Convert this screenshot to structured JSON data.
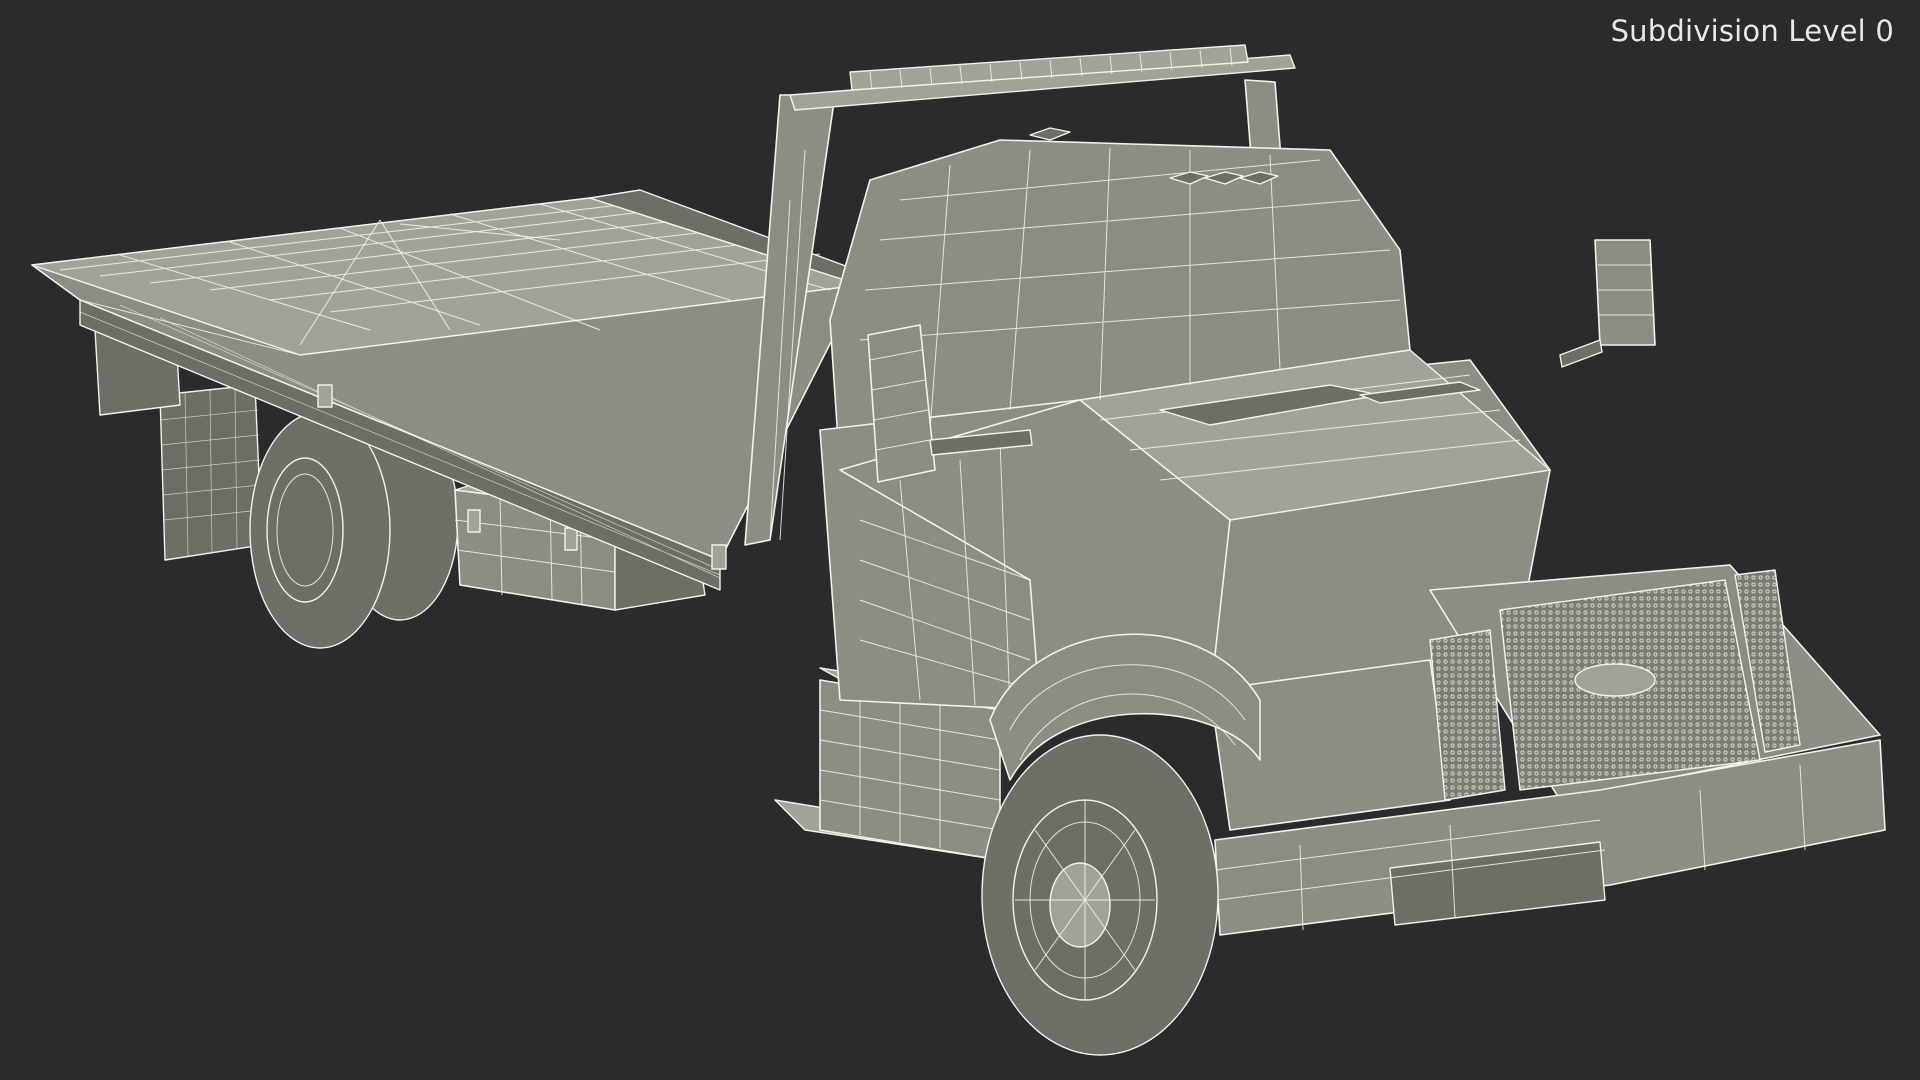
{
  "viewport": {
    "label": "Subdivision Level 0",
    "background_color": "#2b2b2b",
    "model_fill_color": "#8d8d84",
    "wire_color": "#f2f2ec"
  },
  "model": {
    "subject": "flatbed-tow-truck-wireframe"
  }
}
